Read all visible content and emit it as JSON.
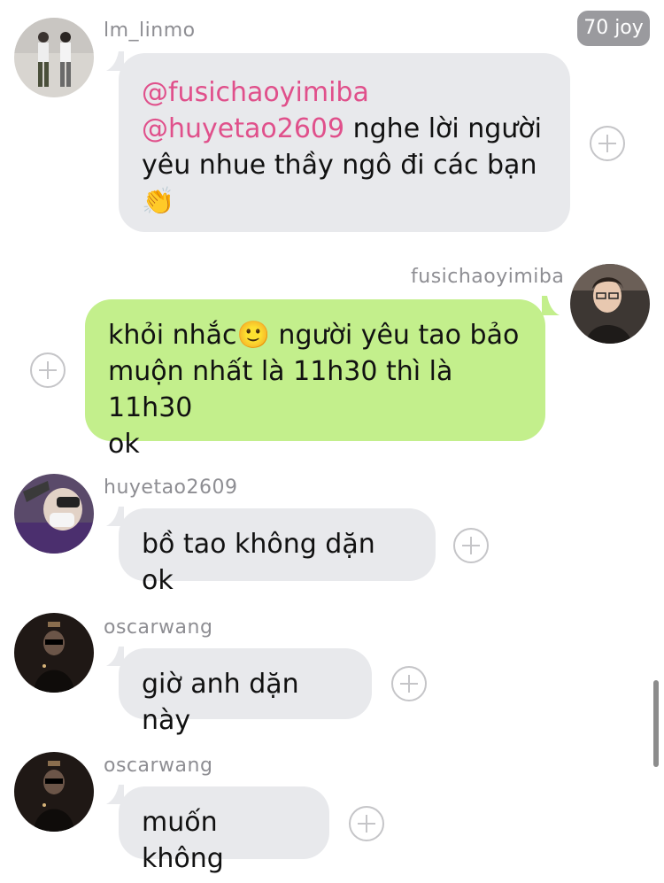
{
  "badge": {
    "label": "70 joy"
  },
  "messages": [
    {
      "username": "lm_linmo",
      "mention1": "@fusichaoyimiba",
      "mention2": "@huyetao2609",
      "text_after_mention": " nghe lời người",
      "line3": "yêu nhue thầy ngô đi các bạn",
      "emoji": "👏"
    },
    {
      "username": "fusichaoyimiba",
      "line1_a": "khỏi nhắc",
      "emoji": "🙂",
      "line1_b": " người yêu tao bảo",
      "line2": "muộn nhất là 11h30 thì là 11h30",
      "line3": "ok"
    },
    {
      "username": "huyetao2609",
      "text": "bồ tao không dặn ok"
    },
    {
      "username": "oscarwang",
      "text": "giờ anh dặn này"
    },
    {
      "username": "oscarwang",
      "text": "muốn không"
    }
  ],
  "colors": {
    "grey_bubble": "#e8e9ec",
    "green_bubble": "#c3ef8c",
    "mention": "#e0508b",
    "username": "#8e8e93"
  },
  "icons": [
    "avatar-photo",
    "plus-circle-icon"
  ]
}
